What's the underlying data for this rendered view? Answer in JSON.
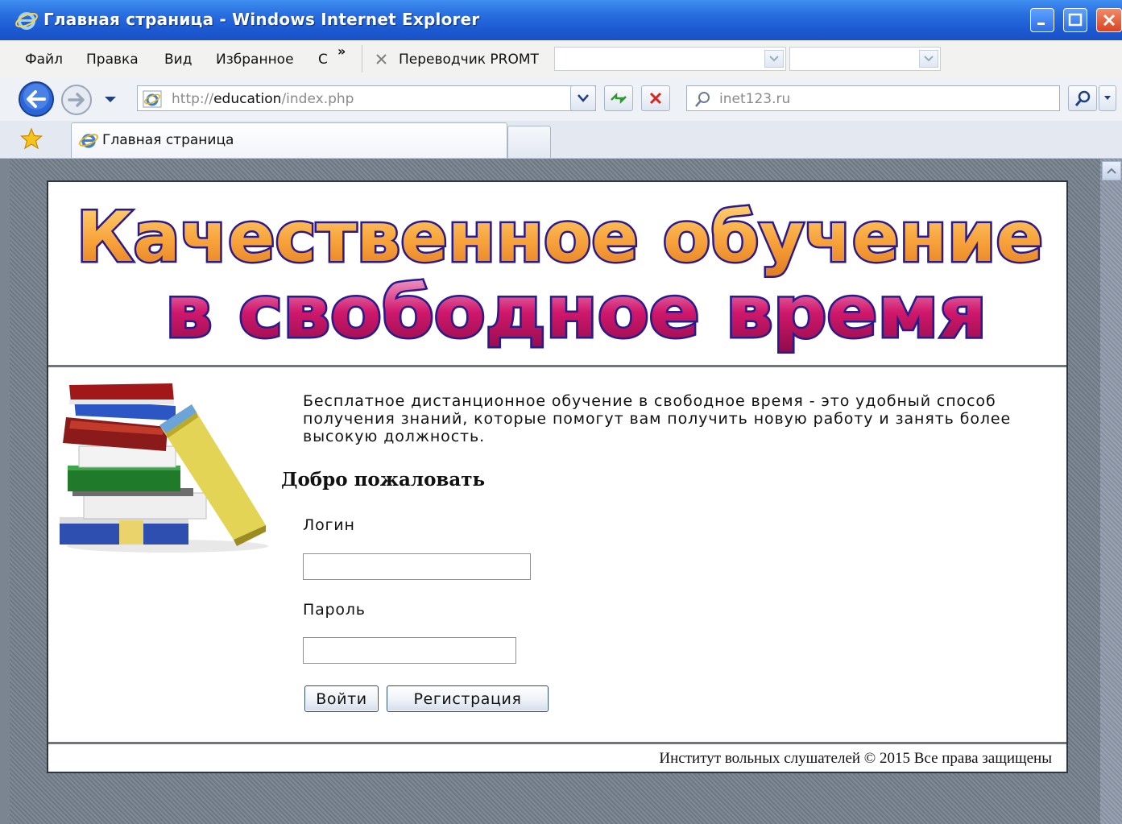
{
  "window": {
    "title": "Главная страница - Windows Internet Explorer"
  },
  "menu": {
    "items": [
      "Файл",
      "Правка",
      "Вид",
      "Избранное",
      "С"
    ],
    "overflow": "»",
    "translator_label": "Переводчик PROMT"
  },
  "address": {
    "url_prefix": "http://",
    "url_host": "education",
    "url_path": "/index.php",
    "search_value": "inet123.ru"
  },
  "tabs": {
    "active_label": "Главная страница"
  },
  "page": {
    "banner_line1": "Качественное обучение",
    "banner_line2": "в свободное время",
    "intro": "Бесплатное дистанционное обучение в свободное время - это удобный способ получения знаний, которые помогут вам получить новую работу и занять более высокую должность.",
    "welcome": "Добро пожаловать",
    "login_label": "Логин",
    "password_label": "Пароль",
    "login_button": "Войти",
    "register_button": "Регистрация",
    "footer": "Институт вольных слушателей © 2015  Все права защищены"
  },
  "colors": {
    "titlebar": "#2a6fe0",
    "page_background": "#7b8591",
    "banner_orange": "#f7a23a",
    "banner_magenta": "#d0186c",
    "banner_outline": "#2a1a8c"
  }
}
